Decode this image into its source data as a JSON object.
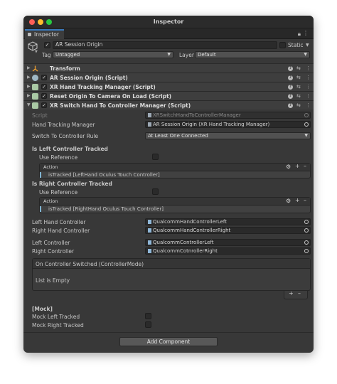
{
  "window": {
    "title": "Inspector"
  },
  "tab": {
    "label": "Inspector"
  },
  "gameobject": {
    "name": "AR Session Origin",
    "static_label": "Static",
    "tag_label": "Tag",
    "tag_value": "Untagged",
    "layer_label": "Layer",
    "layer_value": "Default"
  },
  "components": [
    {
      "name": "Transform",
      "icon": "transform-icon",
      "enabled": null
    },
    {
      "name": "AR Session Origin (Script)",
      "icon": "ar-script-icon",
      "enabled": true
    },
    {
      "name": "XR Hand Tracking Manager (Script)",
      "icon": "script-icon",
      "enabled": true
    },
    {
      "name": "Reset Origin To Camera On Load (Script)",
      "icon": "script-icon",
      "enabled": true
    },
    {
      "name": "XR Switch Hand To Controller Manager (Script)",
      "icon": "script-icon",
      "enabled": true
    }
  ],
  "fields": {
    "script_label": "Script",
    "script_value": "XRSwitchHandToControllerManager",
    "hand_tracking_label": "Hand Tracking Manager",
    "hand_tracking_value": "AR Session Origin (XR Hand Tracking Manager)",
    "switch_rule_label": "Switch To Controller Rule",
    "switch_rule_value": "At Least One Connected",
    "left_tracked_header": "Is Left Controller Tracked",
    "use_reference_label": "Use Reference",
    "action_label": "Action",
    "left_action_binding": "isTracked [LeftHand Oculus Touch Controller]",
    "right_tracked_header": "Is Right Controller Tracked",
    "use_reference_label_2": "Use Reference",
    "action_label_2": "Action",
    "right_action_binding": "isTracked [RightHand Oculus Touch Controller]",
    "left_hand_controller_label": "Left Hand Controller",
    "left_hand_controller_value": "QualcommHandControllerLeft",
    "right_hand_controller_label": "Right Hand Controller",
    "right_hand_controller_value": "QualcommHandControllerRight",
    "left_controller_label": "Left Controller",
    "left_controller_value": "QualcommControllerLeft",
    "right_controller_label": "Right Controller",
    "right_controller_value": "QualcommCotnrollerRight",
    "event_header": "On Controller Switched (ControllerMode)",
    "event_empty": "List is Empty",
    "mock_header": "[Mock]",
    "mock_left_label": "Mock Left Tracked",
    "mock_right_label": "Mock Right Tracked"
  },
  "add_component_label": "Add Component",
  "colors": {
    "accent": "#3a79bb",
    "panel": "#383838",
    "field": "#2a2a2a"
  }
}
